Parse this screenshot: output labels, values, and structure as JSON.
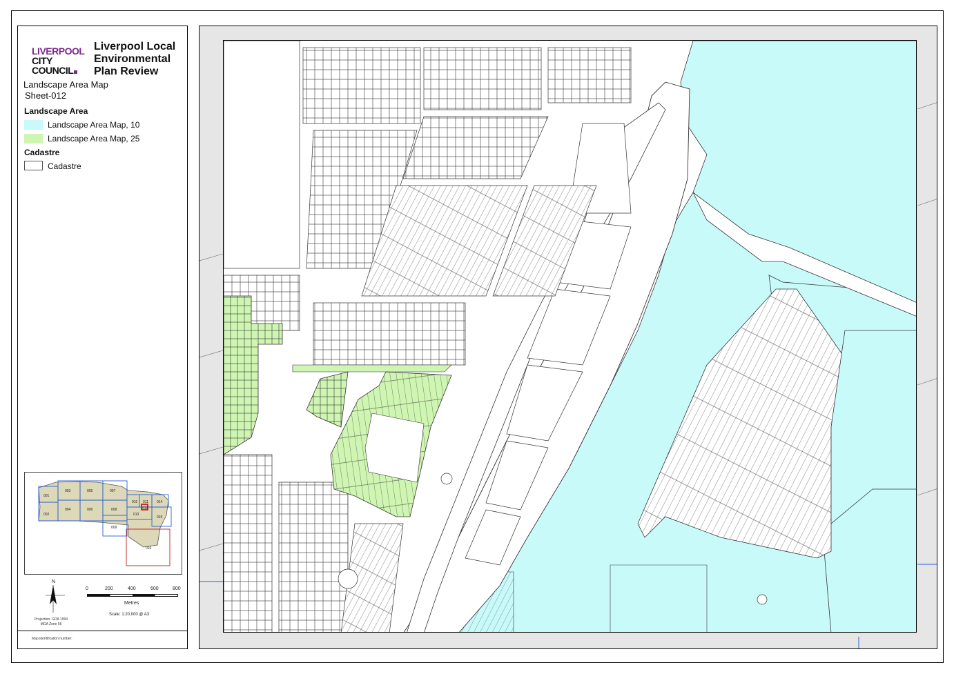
{
  "legend": {
    "logo": {
      "line1": "LIVERPOOL",
      "line2": "CITY",
      "line3": "COUNCIL"
    },
    "title_line1": "Liverpool Local",
    "title_line2": "Environmental",
    "title_line3": "Plan Review",
    "subtitle": "Landscape Area Map",
    "sheet": "Sheet-012",
    "section_landscape": "Landscape Area",
    "items": [
      {
        "label": "Landscape Area Map, 10",
        "color": "#c9fafa"
      },
      {
        "label": "Landscape Area Map, 25",
        "color": "#cff5b2"
      }
    ],
    "section_cadastre": "Cadastre",
    "cadastre_label": "Cadastre"
  },
  "inset": {
    "sheets": [
      "001",
      "002",
      "003",
      "004",
      "005",
      "006",
      "007",
      "008",
      "009",
      "010",
      "011",
      "012",
      "013",
      "014",
      "015",
      "016"
    ],
    "current": "012"
  },
  "north_label": "N",
  "scalebar": {
    "ticks": [
      "0",
      "200",
      "400",
      "600",
      "800"
    ],
    "unit": "Metres",
    "scale_text": "Scale: 1:20,000 @ A3"
  },
  "projection": {
    "line1": "Projection: GDA 1994",
    "line2": "MGA Zone 56"
  },
  "map_id_text": "Map identification number:",
  "colors": {
    "landscape_10": "#c9fafa",
    "landscape_25": "#cff5b2",
    "outside": "#e6e6e6",
    "line": "#333333"
  }
}
